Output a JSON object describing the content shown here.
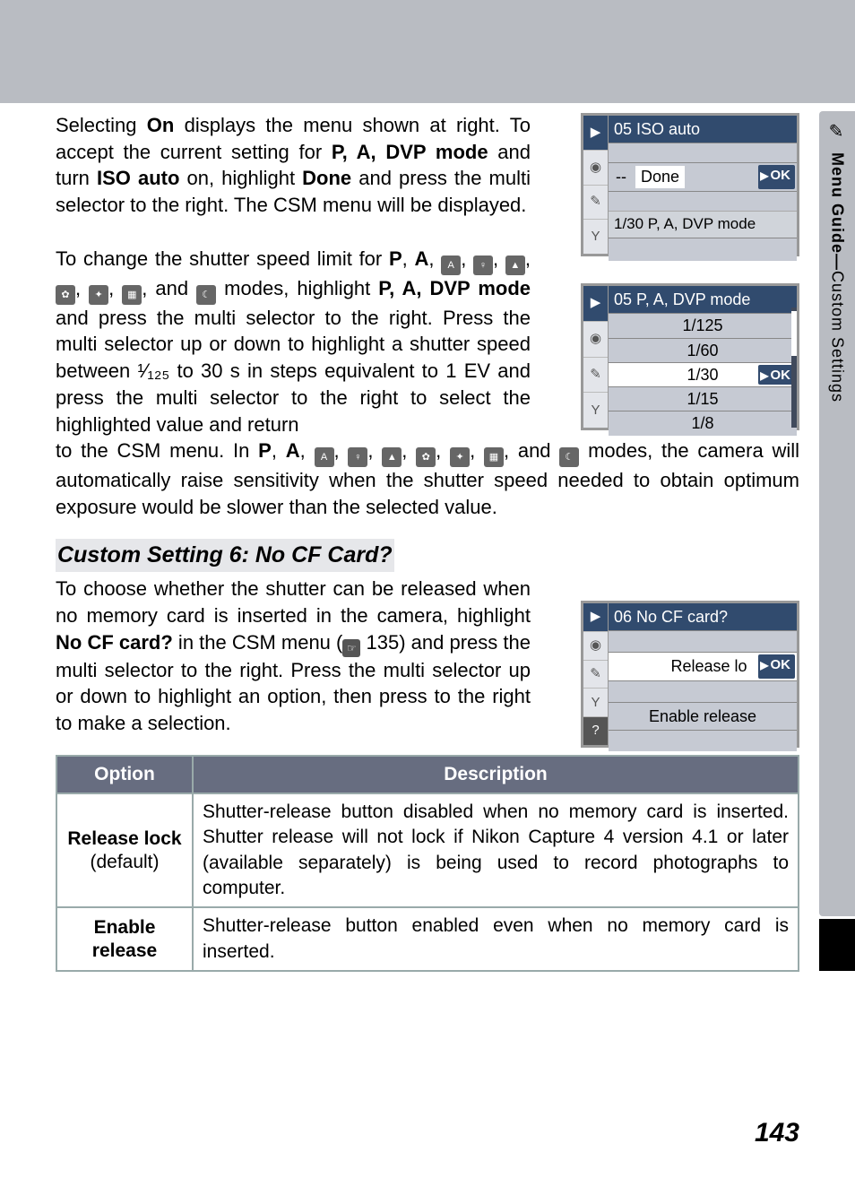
{
  "side_tab": {
    "label_bold": "Menu Guide—",
    "label_thin": "Custom Settings"
  },
  "para1": {
    "t1": "Selecting ",
    "b1": "On",
    "t2": " displays the menu shown at right. To accept the current setting for ",
    "b2": "P, A, DVP mode",
    "t3": " and turn ",
    "b3": "ISO auto",
    "t4": " on, highlight ",
    "b4": "Done",
    "t5": " and press the multi selector to the right.  The CSM menu will be displayed."
  },
  "para2": {
    "t1": "To change the shutter speed limit for ",
    "b1": "P",
    "c1": ", ",
    "b2": "A",
    "t1b": ", ",
    "icons_a": "AUTO, portrait, landscape, macro, sports, night, night-portrait",
    "t2": ", and ",
    "t2b": " modes, highlight ",
    "b3": "P, A, DVP mode",
    "t3": " and press the multi selector to the right. Press the multi selector up or down to highlight a shutter speed between ",
    "frac": "¹⁄₁₂₅",
    "t4": " to 30 s in steps equivalent to 1 EV and press the multi selector to the right to select the highlighted value and return"
  },
  "para2c": {
    "t1": "to the CSM menu.  In ",
    "b1": "P",
    "c1": ", ",
    "b2": "A",
    "t2": ", ",
    "t3": ", and ",
    "t4": " modes, the camera will automatically raise sensitivity when the shutter speed needed to obtain optimum exposure would be slower than the selected value."
  },
  "heading": {
    "prefix": "Custom Setting 6: ",
    "title": "No CF Card?"
  },
  "para3": {
    "t1": "To choose whether the shutter can be released when no memory card is inserted in the camera, highlight ",
    "b1": "No CF card?",
    "t2": " in the CSM menu (",
    "ref": "135",
    "t3": ") and press the multi selector to the right.  Press the multi selector up or down to highlight an option, then press to the right to make a selection."
  },
  "ms1": {
    "title": "05 ISO auto",
    "done": "Done",
    "dashes": "--",
    "sub": "1/30 P, A, DVP mode",
    "ok": "OK"
  },
  "ms2": {
    "title": "05 P, A, DVP mode",
    "items": [
      "1/125",
      "1/60",
      "1/30",
      "1/15",
      "1/8"
    ],
    "ok": "OK"
  },
  "ms3": {
    "title": "06 No CF card?",
    "row1": "Release lo",
    "row2": "Enable release",
    "ok": "OK"
  },
  "table": {
    "head_option": "Option",
    "head_desc": "Description",
    "rows": [
      {
        "name": "Release lock",
        "def": "(default)",
        "desc": "Shutter-release button disabled when no memory card is inserted. Shutter release will not lock if Nikon Capture 4 version 4.1 or later (available separately) is being used to record photographs to computer."
      },
      {
        "name": "Enable release",
        "def": "",
        "desc": "Shutter-release button enabled even when no memory card is inserted."
      }
    ]
  },
  "page_number": "143"
}
